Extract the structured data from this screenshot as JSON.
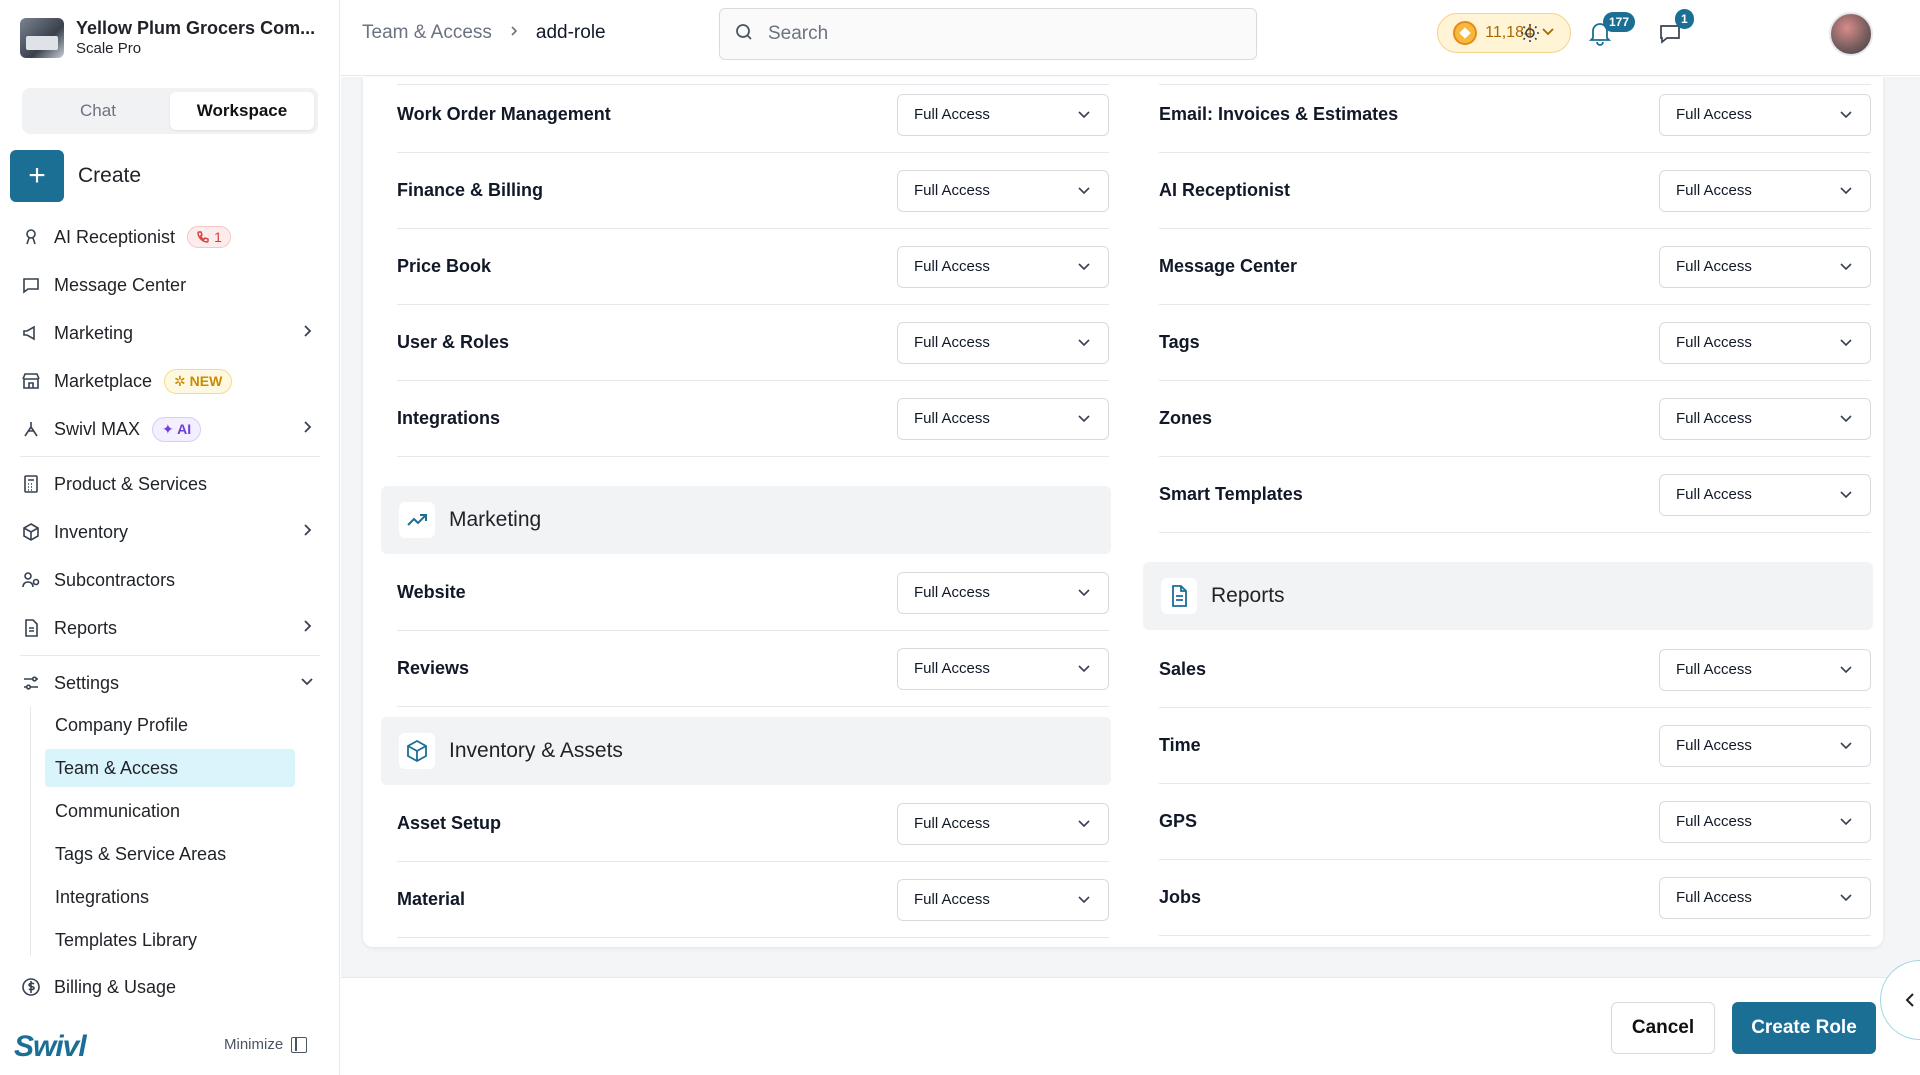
{
  "brand": {
    "name": "Yellow Plum Grocers Com...",
    "plan": "Scale Pro"
  },
  "mode_tabs": [
    "Chat",
    "Workspace"
  ],
  "create_label": "Create",
  "nav": {
    "ai_receptionist": "AI Receptionist",
    "ai_receptionist_badge": "1",
    "message_center": "Message Center",
    "marketing": "Marketing",
    "marketplace": "Marketplace",
    "marketplace_badge": "NEW",
    "swivl_max": "Swivl MAX",
    "swivl_max_badge": "AI",
    "product_services": "Product & Services",
    "inventory": "Inventory",
    "subcontractors": "Subcontractors",
    "reports": "Reports",
    "settings": "Settings",
    "billing": "Billing & Usage"
  },
  "settings_items": [
    "Company Profile",
    "Team & Access",
    "Communication",
    "Tags & Service Areas",
    "Integrations",
    "Templates Library"
  ],
  "footer": {
    "logo": "Swivl",
    "minimize": "Minimize"
  },
  "header": {
    "breadcrumb_parent": "Team & Access",
    "breadcrumb_current": "add-role",
    "search_placeholder": "Search",
    "coins": "11,184",
    "notifications_count": "177",
    "messages_count": "1"
  },
  "access_value": "Full Access",
  "left_top_rows": [
    "Work Order Management",
    "Finance & Billing",
    "Price Book",
    "User & Roles",
    "Integrations"
  ],
  "marketing_section": {
    "title": "Marketing",
    "rows": [
      "Website",
      "Reviews"
    ]
  },
  "inventory_section": {
    "title": "Inventory & Assets",
    "rows": [
      "Asset Setup",
      "Material"
    ]
  },
  "right_top_rows": [
    "Email: Invoices & Estimates",
    "AI Receptionist",
    "Message Center",
    "Tags",
    "Zones",
    "Smart Templates"
  ],
  "reports_section": {
    "title": "Reports",
    "rows": [
      "Sales",
      "Time",
      "GPS",
      "Jobs"
    ]
  },
  "actions": {
    "cancel": "Cancel",
    "create_role": "Create Role"
  }
}
